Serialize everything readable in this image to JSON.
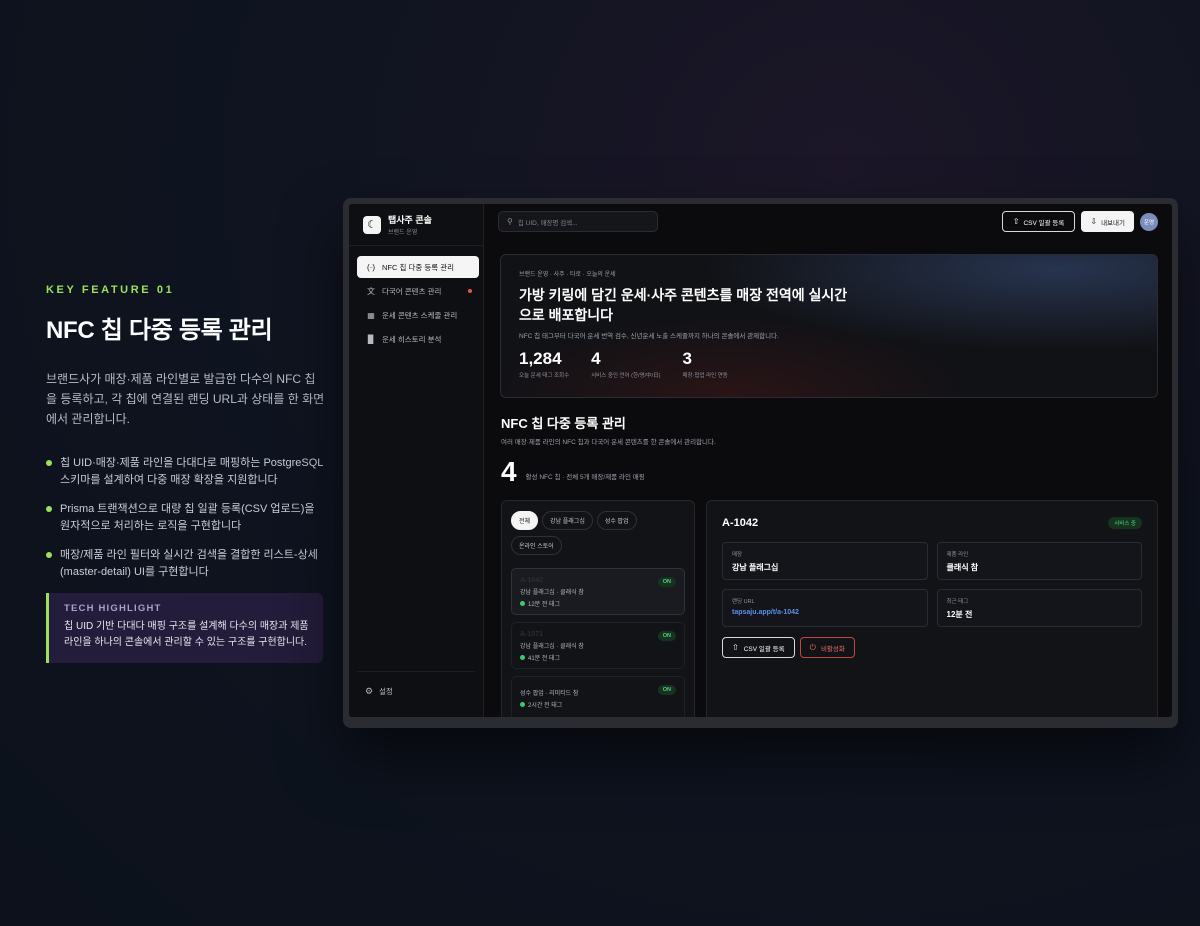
{
  "intro": {
    "key_feature": "KEY FEATURE 01",
    "title": "NFC 칩 다중 등록 관리",
    "description": "브랜드사가 매장·제품 라인별로 발급한 다수의 NFC 칩을 등록하고, 각 칩에 연결된 랜딩 URL과 상태를 한 화면에서 관리합니다.",
    "bullets": [
      "칩 UID·매장·제품 라인을 다대다로 매핑하는 PostgreSQL 스키마를 설계하여 다중 매장 확장을 지원합니다",
      "Prisma 트랜잭션으로 대량 칩 일괄 등록(CSV 업로드)을 원자적으로 처리하는 로직을 구현합니다",
      "매장/제품 라인 필터와 실시간 검색을 결합한 리스트-상세(master-detail) UI를 구현합니다"
    ],
    "tech_highlight": {
      "heading": "TECH HIGHLIGHT",
      "body": "칩 UID 기반 다대다 매핑 구조를 설계해 다수의 매장과 제품 라인을 하나의 콘솔에서 관리할 수 있는 구조를 구현합니다."
    }
  },
  "app": {
    "brand_name": "탭사주 콘솔",
    "brand_sub": "브랜드 운영",
    "nav": [
      {
        "label": "NFC 칩 다중 등록 관리",
        "icon": "nfc-icon",
        "active": true
      },
      {
        "label": "다국어 콘텐츠 관리",
        "icon": "translate-icon",
        "badge": true
      },
      {
        "label": "운세 콘텐츠 스케줄 관리",
        "icon": "calendar-icon"
      },
      {
        "label": "운세 히스토리 분석",
        "icon": "bar-chart-icon"
      }
    ],
    "settings_label": "설정",
    "search_placeholder": "칩 UID, 매장명 검색...",
    "csv_button": "CSV 일괄 등록",
    "export_button": "내보내기",
    "avatar_text": "운영"
  },
  "hero": {
    "breadcrumb": "브랜드 운영 · 사주 · 타로 · 오늘의 운세",
    "title": "가방 키링에 담긴 운세·사주 콘텐츠를 매장 전역에 실시간으로 배포합니다",
    "subtitle": "NFC 칩 태그부터 다국어 운세 번역 검수, 신년운세 노출 스케줄까지 하나의 콘솔에서 관제합니다.",
    "stats": [
      {
        "value": "1,284",
        "label": "오늘 운세 태그 조회수"
      },
      {
        "value": "4",
        "label": "서비스 중인 언어 (한/영/中/日)"
      },
      {
        "value": "3",
        "label": "매장·팝업 라인 연동"
      }
    ]
  },
  "section": {
    "title": "NFC 칩 다중 등록 관리",
    "description": "여러 매장·제품 라인의 NFC 칩과 다국어 운세 콘텐츠를 한 콘솔에서 관리합니다.",
    "count": "4",
    "count_label": "활성 NFC 칩 · 전체 5개 매장/제품 라인 매핑"
  },
  "filters": [
    "전체",
    "강남 플래그십",
    "성수 팝업",
    "온라인 스토어"
  ],
  "chips": [
    {
      "uid": "A-1042",
      "status": "ON",
      "location": "강남 플래그십 · 클래식 참",
      "time": "12분 전 태그"
    },
    {
      "uid": "A-1071",
      "status": "ON",
      "location": "강남 플래그십 · 클래식 참",
      "time": "41분 전 태그"
    },
    {
      "uid": "",
      "status": "ON",
      "location": "성수 팝업 · 리미티드 참",
      "time": "2시간 전 태그"
    }
  ],
  "detail": {
    "uid": "A-1042",
    "status_badge": "서비스 중",
    "fields": [
      {
        "label": "매장",
        "value": "강남 플래그십"
      },
      {
        "label": "제품 라인",
        "value": "클래식 참"
      },
      {
        "label": "랜딩 URL",
        "value": "tapsaju.app/t/a-1042",
        "link": true
      },
      {
        "label": "최근 태그",
        "value": "12분 전"
      }
    ],
    "csv_button": "CSV 일괄 등록",
    "deactivate_button": "비활성화"
  },
  "colors": {
    "accent": "#9be15d",
    "background": "#0f1420",
    "on_status": "#4fd17f",
    "danger": "#e36b61",
    "link": "#5b8fe8"
  }
}
